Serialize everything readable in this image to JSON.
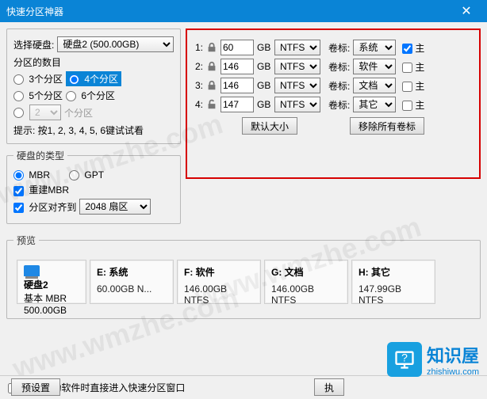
{
  "title": "快速分区神器",
  "left": {
    "select_disk_label": "选择硬盘:",
    "disk_value": "硬盘2 (500.00GB)",
    "partition_count_title": "分区的数目",
    "p3": "3个分区",
    "p4": "4个分区",
    "p5": "5个分区",
    "p6": "6个分区",
    "custom_label": "个分区",
    "custom_value": "2",
    "hint": "提示: 按1, 2, 3, 4, 5, 6键试试看",
    "disk_type_title": "硬盘的类型",
    "mbr": "MBR",
    "gpt": "GPT",
    "rebuild_mbr": "重建MBR",
    "align_label": "分区对齐到",
    "align_value": "2048 扇区"
  },
  "parts": {
    "unit": "GB",
    "vol_label": "卷标:",
    "primary": "主",
    "rows": [
      {
        "idx": "1:",
        "size": "60",
        "fs": "NTFS",
        "vol": "系统",
        "primary": true,
        "locked": true
      },
      {
        "idx": "2:",
        "size": "146",
        "fs": "NTFS",
        "vol": "软件",
        "primary": false,
        "locked": true
      },
      {
        "idx": "3:",
        "size": "146",
        "fs": "NTFS",
        "vol": "文档",
        "primary": false,
        "locked": true
      },
      {
        "idx": "4:",
        "size": "147",
        "fs": "NTFS",
        "vol": "其它",
        "primary": false,
        "locked": false
      }
    ],
    "btn_default": "默认大小",
    "btn_clear": "移除所有卷标"
  },
  "preview": {
    "title": "预览",
    "disk": {
      "name": "硬盘2",
      "type": "基本 MBR",
      "size": "500.00GB"
    },
    "items": [
      {
        "name": "E: 系统",
        "size": "60.00GB N..."
      },
      {
        "name": "F: 软件",
        "size": "146.00GB NTFS"
      },
      {
        "name": "G: 文档",
        "size": "146.00GB NTFS"
      },
      {
        "name": "H: 其它",
        "size": "147.99GB NTFS"
      }
    ]
  },
  "bottom": {
    "next_boot": "下次启动软件时直接进入快速分区窗口",
    "preset": "预设置",
    "exec": "执"
  },
  "brand": "知识屋",
  "brand_sub": "zhishiwu.com",
  "wm": "www.wmzhe.com"
}
